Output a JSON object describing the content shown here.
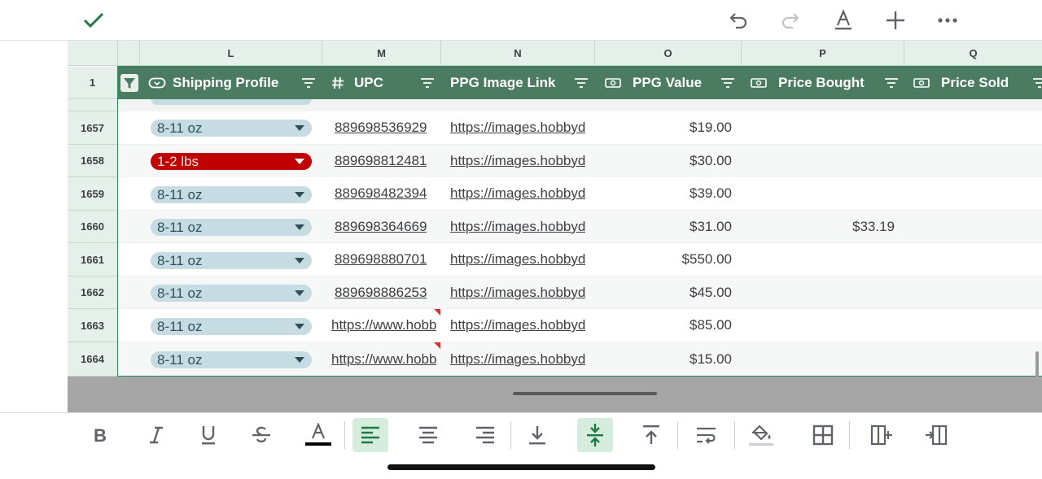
{
  "columns": [
    "L",
    "M",
    "N",
    "O",
    "P",
    "Q"
  ],
  "header_row_number": "1",
  "table_headers": {
    "shipping_profile": "Shipping Profile",
    "upc": "UPC",
    "ppg_image_link": "PPG Image Link",
    "ppg_value": "PPG Value",
    "price_bought": "Price Bought",
    "price_sold": "Price Sold"
  },
  "rows": [
    {
      "num": "1657",
      "shipping": "8-11 oz",
      "shipping_status": "default",
      "upc": "889698536929",
      "image_link": "https://images.hobbyd",
      "ppg_value": "$19.00",
      "price_bought": "",
      "price_sold": ""
    },
    {
      "num": "1658",
      "shipping": "1-2 lbs",
      "shipping_status": "alert",
      "upc": "889698812481",
      "image_link": "https://images.hobbyd",
      "ppg_value": "$30.00",
      "price_bought": "",
      "price_sold": ""
    },
    {
      "num": "1659",
      "shipping": "8-11 oz",
      "shipping_status": "default",
      "upc": "889698482394",
      "image_link": "https://images.hobbyd",
      "ppg_value": "$39.00",
      "price_bought": "",
      "price_sold": ""
    },
    {
      "num": "1660",
      "shipping": "8-11 oz",
      "shipping_status": "default",
      "upc": "889698364669",
      "image_link": "https://images.hobbyd",
      "ppg_value": "$31.00",
      "price_bought": "$33.19",
      "price_sold": ""
    },
    {
      "num": "1661",
      "shipping": "8-11 oz",
      "shipping_status": "default",
      "upc": "889698880701",
      "image_link": "https://images.hobbyd",
      "ppg_value": "$550.00",
      "price_bought": "",
      "price_sold": ""
    },
    {
      "num": "1662",
      "shipping": "8-11 oz",
      "shipping_status": "default",
      "upc": "889698886253",
      "image_link": "https://images.hobbyd",
      "ppg_value": "$45.00",
      "price_bought": "",
      "price_sold": ""
    },
    {
      "num": "1663",
      "shipping": "8-11 oz",
      "shipping_status": "default",
      "upc": "https://www.hobb",
      "upc_has_note": true,
      "image_link": "https://images.hobbyd",
      "ppg_value": "$85.00",
      "price_bought": "",
      "price_sold": ""
    },
    {
      "num": "1664",
      "shipping": "8-11 oz",
      "shipping_status": "default",
      "upc": "https://www.hobb",
      "upc_has_note": true,
      "image_link": "https://images.hobbyd",
      "ppg_value": "$15.00",
      "price_bought": "",
      "price_sold": ""
    }
  ],
  "colors": {
    "header_bg": "#4b7b61",
    "chip_default": "#c7dbe2",
    "chip_alert": "#c00000",
    "accent": "#1e7a45"
  },
  "toolbar_top": [
    "check-icon",
    "undo-icon",
    "redo-icon",
    "text-color-icon",
    "add-icon",
    "more-icon"
  ],
  "toolbar_bottom": [
    "bold-icon",
    "italic-icon",
    "underline-icon",
    "strikethrough-icon",
    "text-color-icon",
    "align-left-icon",
    "align-center-icon",
    "align-right-icon",
    "valign-bottom-icon",
    "valign-middle-icon",
    "valign-top-icon",
    "wrap-text-icon",
    "fill-color-icon",
    "borders-icon",
    "insert-column-right-icon",
    "insert-column-left-icon"
  ],
  "toolbar_active": [
    "align-left-icon",
    "valign-middle-icon"
  ]
}
